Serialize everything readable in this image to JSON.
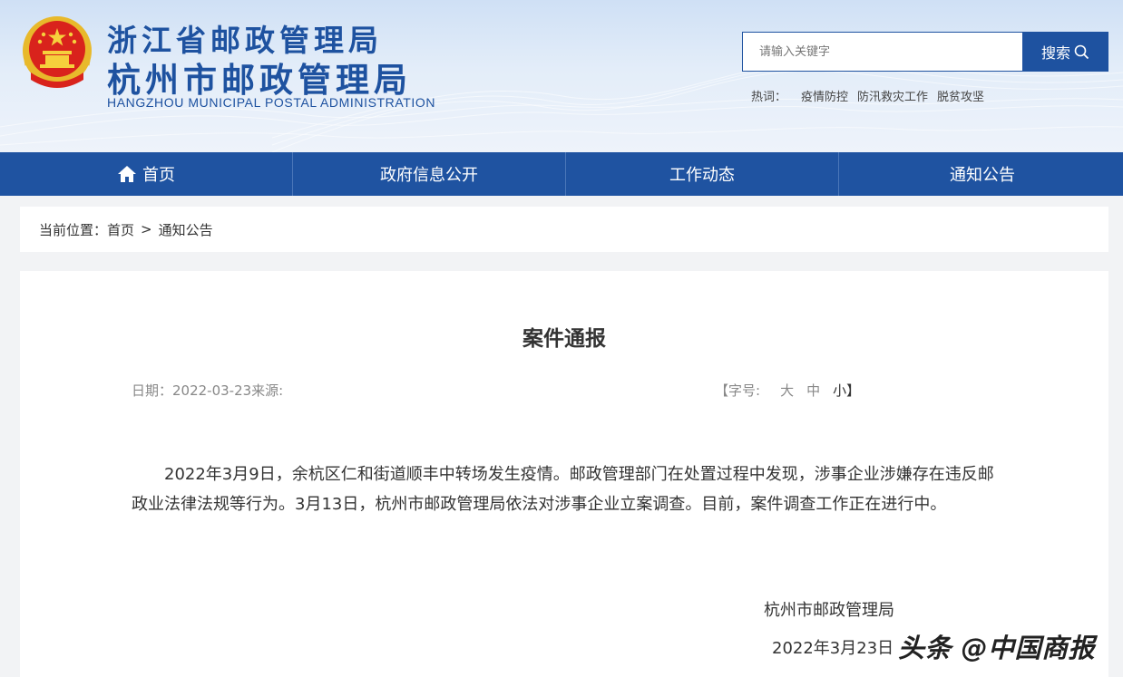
{
  "header": {
    "title_line1": "浙江省邮政管理局",
    "title_line2": "杭州市邮政管理局",
    "title_en": "HANGZHOU  MUNICIPAL POSTAL ADMINISTRATION"
  },
  "search": {
    "placeholder": "请输入关键字",
    "button_label": "搜索"
  },
  "hotwords": {
    "label": "热词：",
    "items": [
      "疫情防控",
      "防汛救灾工作",
      "脱贫攻坚"
    ]
  },
  "nav": {
    "items": [
      "首页",
      "政府信息公开",
      "工作动态",
      "通知公告"
    ]
  },
  "breadcrumb": {
    "prefix": "当前位置：",
    "items": [
      "首页",
      "通知公告"
    ],
    "separator": ">"
  },
  "article": {
    "title": "案件通报",
    "meta_date": "日期：2022-03-23来源:",
    "font_size_label": "【字号:",
    "font_sizes": [
      "大",
      "中",
      "小】"
    ],
    "body": "2022年3月9日，余杭区仁和街道顺丰中转场发生疫情。邮政管理部门在处置过程中发现，涉事企业涉嫌存在违反邮政业法律法规等行为。3月13日，杭州市邮政管理局依法对涉事企业立案调查。目前，案件调查工作正在进行中。",
    "sign_org": "杭州市邮政管理局",
    "sign_date": "2022年3月23日"
  },
  "watermark": "头条 @中国商报",
  "colors": {
    "brand_blue": "#1e52a0",
    "nav_blue": "#1f53a1",
    "page_bg": "#f2f3f5"
  },
  "icons": {
    "emblem": "national-emblem-icon",
    "search": "search-icon",
    "home": "home-icon"
  }
}
